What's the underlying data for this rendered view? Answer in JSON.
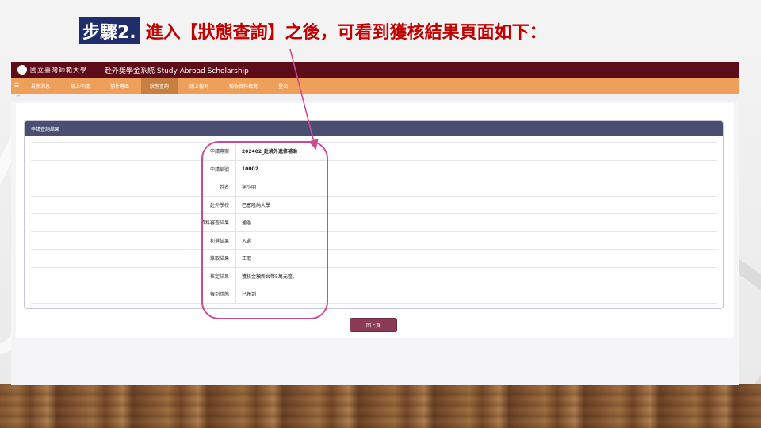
{
  "caption": {
    "step_label": "步驟2.",
    "text": "進入【狀態查詢】之後，可看到獲核結果頁面如下："
  },
  "app": {
    "university_name": "國立臺灣師範大學",
    "system_title": "赴外獎學金系統  Study Abroad Scholarship"
  },
  "menu": {
    "items": [
      {
        "label": "最新消息",
        "active": false
      },
      {
        "label": "線上申請",
        "active": false
      },
      {
        "label": "補件專區",
        "active": false
      },
      {
        "label": "狀態查詢",
        "active": true
      },
      {
        "label": "線上報到",
        "active": false
      },
      {
        "label": "驗收資料填寫",
        "active": false
      },
      {
        "label": "登出",
        "active": false
      }
    ]
  },
  "panel": {
    "title": "申請查詢結果"
  },
  "result": {
    "rows": [
      {
        "label": "申請專案",
        "value": "202402_赴境外進修補助",
        "bold": true
      },
      {
        "label": "申請編號",
        "value": "10002",
        "bold": true
      },
      {
        "label": "姓名",
        "value": "李小明",
        "bold": false
      },
      {
        "label": "赴外學校",
        "value": "巴塞隆納大學",
        "bold": false
      },
      {
        "label": "資料審查結果",
        "value": "通過",
        "bold": false
      },
      {
        "label": "初選結果",
        "value": "入選",
        "bold": false
      },
      {
        "label": "錄取結果",
        "value": "正取",
        "bold": false
      },
      {
        "label": "核定結果",
        "value": "獲核金額新台幣5萬元整。",
        "bold": false
      },
      {
        "label": "報到狀態",
        "value": "已報到",
        "bold": false
      }
    ]
  },
  "buttons": {
    "back": "回上頁"
  },
  "colors": {
    "caption_red": "#c00000",
    "topbar": "#5e0b1a",
    "menubar": "#ee9f5a",
    "panel_header": "#4a4e72",
    "back_button": "#8c3b56",
    "highlight": "#cc4c93"
  }
}
